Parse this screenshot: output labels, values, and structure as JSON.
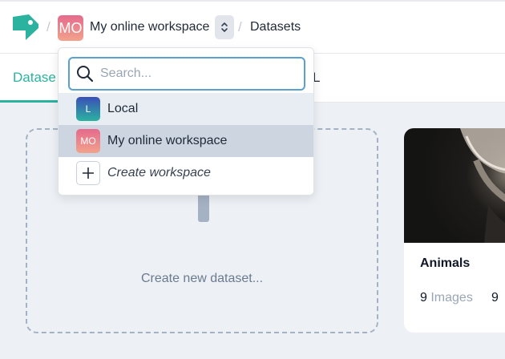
{
  "breadcrumb": {
    "separator": "/",
    "workspace_initials": "MO",
    "workspace_name": "My online workspace",
    "page": "Datasets"
  },
  "tabs": {
    "active_label": "Datase",
    "other_label": "L"
  },
  "main": {
    "create_label": "Create new dataset...",
    "dataset": {
      "name": "Animals",
      "stats": [
        {
          "count": "9",
          "label": "Images"
        },
        {
          "count": "9",
          "label": ""
        }
      ]
    }
  },
  "workspace_menu": {
    "search_placeholder": "Search...",
    "items": [
      {
        "initials": "L",
        "label": "Local"
      },
      {
        "initials": "MO",
        "label": "My online workspace",
        "selected": true
      },
      {
        "initials": "",
        "icon": "plus-icon",
        "label": "Create workspace"
      }
    ]
  },
  "colors": {
    "accent": "#2bb3a0",
    "focus_ring": "#5aa0d0",
    "background": "#edf1f5"
  }
}
